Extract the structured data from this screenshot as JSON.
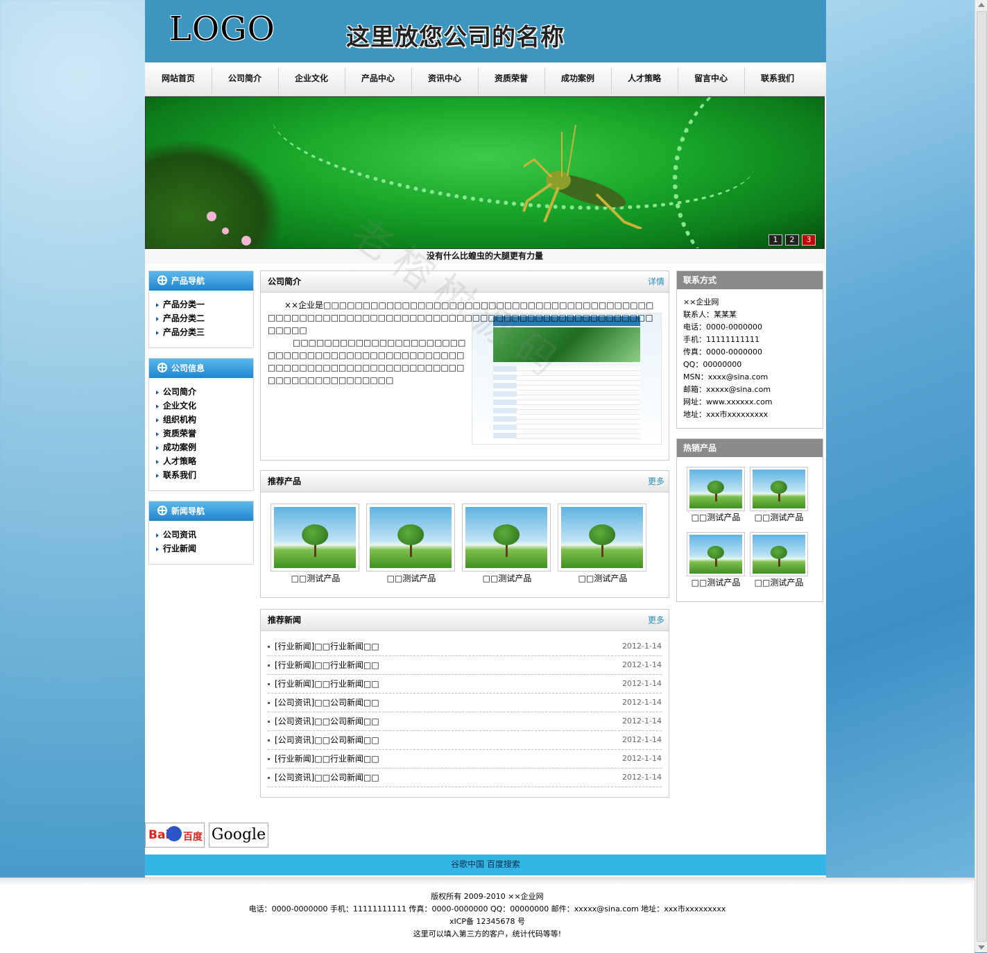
{
  "header": {
    "logo": "LOGO",
    "company_name": "这里放您公司的名称"
  },
  "nav": [
    "网站首页",
    "公司简介",
    "企业文化",
    "产品中心",
    "资讯中心",
    "资质荣誉",
    "成功案例",
    "人才策略",
    "留言中心",
    "联系我们"
  ],
  "banner": {
    "caption": "没有什么比蝗虫的大腿更有力量",
    "slides": [
      "1",
      "2",
      "3"
    ],
    "active_slide": 3
  },
  "sidebar": {
    "product_nav": {
      "title": "产品导航",
      "items": [
        "产品分类一",
        "产品分类二",
        "产品分类三"
      ]
    },
    "company_info": {
      "title": "公司信息",
      "items": [
        "公司简介",
        "企业文化",
        "组织机构",
        "资质荣誉",
        "成功案例",
        "人才策略",
        "联系我们"
      ]
    },
    "news_nav": {
      "title": "新闻导航",
      "items": [
        "公司资讯",
        "行业新闻"
      ]
    }
  },
  "intro": {
    "title": "公司简介",
    "more": "详情",
    "paragraph1": "××企业是□□□□□□□□□□□□□□□□□□□□□□□□□□□□□□□□□□□□□□□□□□□□□□□□□□□□□□□□□□□□□□□□□□□□□□□□□□□□□□□□□□□□□□□□□□□□□□□□",
    "paragraph2": "□□□□□□□□□□□□□□□□□□□□□□□□□□□□□□□□□□□□□□□□□□□□□□□□□□□□□□□□□□□□□□□□□□□□□□□□□□□□□□□□□□□□□□□□"
  },
  "recommended_products": {
    "title": "推荐产品",
    "more": "更多",
    "items": [
      "□□测试产品",
      "□□测试产品",
      "□□测试产品",
      "□□测试产品"
    ]
  },
  "recommended_news": {
    "title": "推荐新闻",
    "more": "更多",
    "items": [
      {
        "title": "[行业新闻]□□行业新闻□□",
        "date": "2012-1-14"
      },
      {
        "title": "[行业新闻]□□行业新闻□□",
        "date": "2012-1-14"
      },
      {
        "title": "[行业新闻]□□行业新闻□□",
        "date": "2012-1-14"
      },
      {
        "title": "[公司资讯]□□公司新闻□□",
        "date": "2012-1-14"
      },
      {
        "title": "[公司资讯]□□公司新闻□□",
        "date": "2012-1-14"
      },
      {
        "title": "[公司资讯]□□公司新闻□□",
        "date": "2012-1-14"
      },
      {
        "title": "[行业新闻]□□行业新闻□□",
        "date": "2012-1-14"
      },
      {
        "title": "[公司资讯]□□公司新闻□□",
        "date": "2012-1-14"
      }
    ]
  },
  "contact": {
    "title": "联系方式",
    "lines": [
      "××企业网",
      "联系人：某某某",
      "电话：0000-0000000",
      "手机：11111111111",
      "传真：0000-0000000",
      "QQ：00000000",
      "MSN：xxxx@sina.com",
      "邮箱：xxxxx@sina.com",
      "网址：www.xxxxxx.com",
      "地址：xxx市xxxxxxxxx"
    ]
  },
  "hot_products": {
    "title": "热销产品",
    "items": [
      "□□测试产品",
      "□□测试产品",
      "□□测试产品",
      "□□测试产品"
    ]
  },
  "friend_links": {
    "baidu_logo": {
      "part1": "Bai",
      "part2": "百度"
    },
    "google_logo": "Google",
    "text": "谷歌中国 百度搜索"
  },
  "footer": {
    "lines": [
      "版权所有 2009-2010 ××企业网",
      "电话：0000-0000000 手机：11111111111 传真：0000-0000000 QQ：00000000 邮件：xxxxx@sina.com 地址：xxx市xxxxxxxxx",
      "xICP备 12345678 号",
      "这里可以填入第三方的客户，统计代码等等!"
    ]
  },
  "watermark": "老榕树源码",
  "colors": {
    "header_bg": "#3c96bf",
    "sidebar_header": "#1d86cf",
    "friend_bar": "#33b6e6",
    "active_slide": "#c00000",
    "right_header": "#8a8a8a"
  }
}
